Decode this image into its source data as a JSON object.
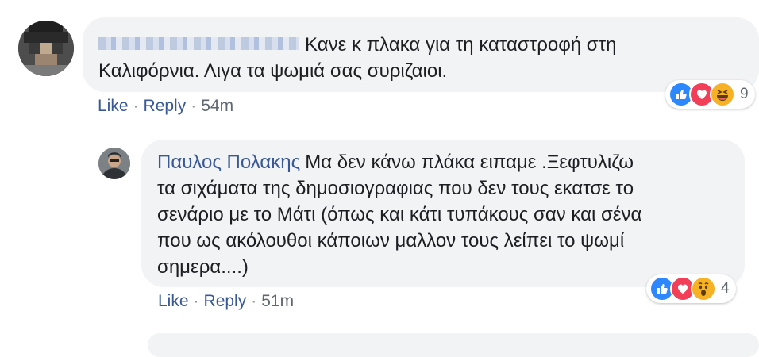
{
  "comment1": {
    "text_line1": "Κανε κ πλακα για τη καταστροφή στη",
    "text_line2": "Καλιφόρνια. Λιγα τα ψωμιά σας συριζαιοι.",
    "like": "Like",
    "reply": "Reply",
    "time": "54m",
    "reaction_count": "9",
    "reactions": [
      "like-icon",
      "love-icon",
      "haha-icon"
    ]
  },
  "comment2": {
    "author": "Παυλος Πολακης",
    "text_line1": "Μα δεν κάνω πλάκα ειπαμε .Ξεφτυλιζω",
    "text_line2": "τα σιχάματα της δημοσιογραφιας που δεν τους εκατσε το",
    "text_line3": "σενάριο με το Μάτι (όπως και κάτι τυπάκους σαν και σένα",
    "text_line4": "που ως ακόλουθοι κάποιων μαλλον τους λείπει το ψωμί",
    "text_line5": "σημερα....)",
    "like": "Like",
    "reply": "Reply",
    "time": "51m",
    "reaction_count": "4",
    "reactions": [
      "like-icon",
      "love-icon",
      "wow-icon"
    ]
  },
  "separator": "·",
  "colors": {
    "link": "#385898",
    "bubble": "#f2f3f5",
    "like": "#2d88ff",
    "love": "#f33e58",
    "haha": "#f7b125"
  }
}
